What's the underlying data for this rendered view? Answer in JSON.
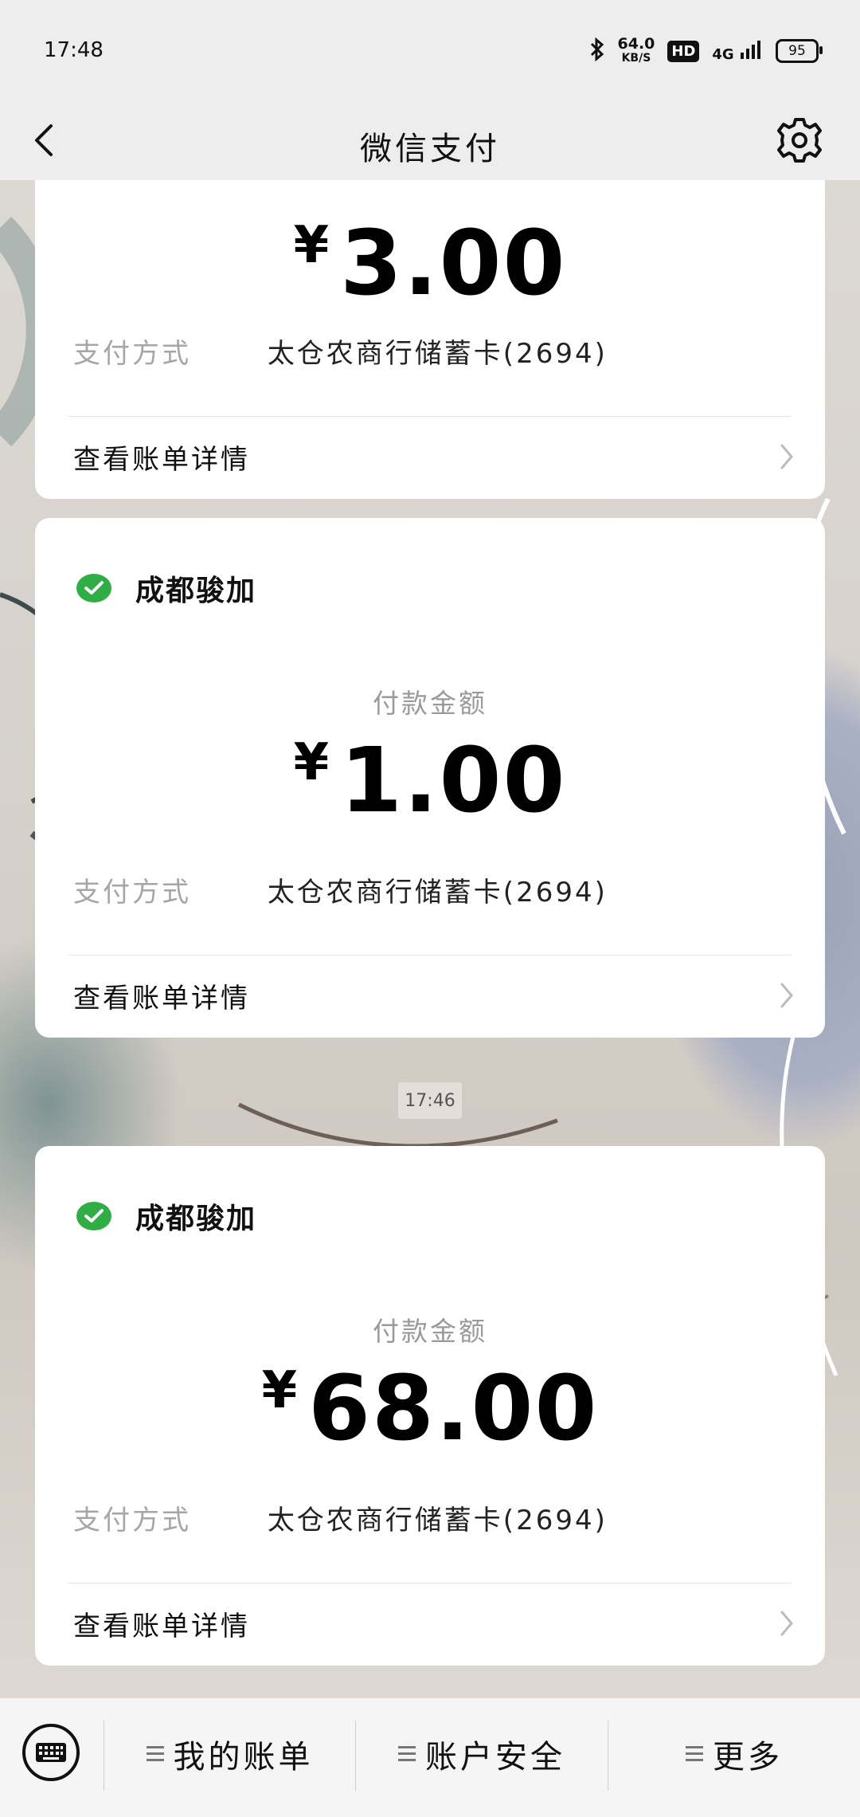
{
  "status_bar": {
    "time": "17:48",
    "net_speed": "64.0",
    "net_speed_unit": "KB/S",
    "hd": "HD",
    "network": "4G",
    "battery": "95"
  },
  "nav": {
    "title": "微信支付"
  },
  "cards": [
    {
      "amount_currency": "¥",
      "amount": "3.00",
      "pay_method_label": "支付方式",
      "pay_method_value": "太仓农商行储蓄卡(2694)",
      "detail_label": "查看账单详情"
    },
    {
      "merchant": "成都骏加",
      "amount_label": "付款金额",
      "amount_currency": "¥",
      "amount": "1.00",
      "pay_method_label": "支付方式",
      "pay_method_value": "太仓农商行储蓄卡(2694)",
      "detail_label": "查看账单详情"
    },
    {
      "merchant": "成都骏加",
      "amount_label": "付款金额",
      "amount_currency": "¥",
      "amount": "68.00",
      "pay_method_label": "支付方式",
      "pay_method_value": "太仓农商行储蓄卡(2694)",
      "detail_label": "查看账单详情"
    }
  ],
  "timestamp": "17:46",
  "bottom_bar": {
    "items": [
      {
        "label": "我的账单"
      },
      {
        "label": "账户安全"
      },
      {
        "label": "更多"
      }
    ]
  },
  "colors": {
    "accent_green": "#2fae45",
    "bar_bg": "#ededed"
  },
  "icons": {
    "back": "chevron-left-icon",
    "settings": "gear-icon",
    "merchant": "wechat-pay-icon",
    "keyboard": "keyboard-icon",
    "menu": "menu-lines-icon",
    "chevron": "chevron-right-icon"
  }
}
